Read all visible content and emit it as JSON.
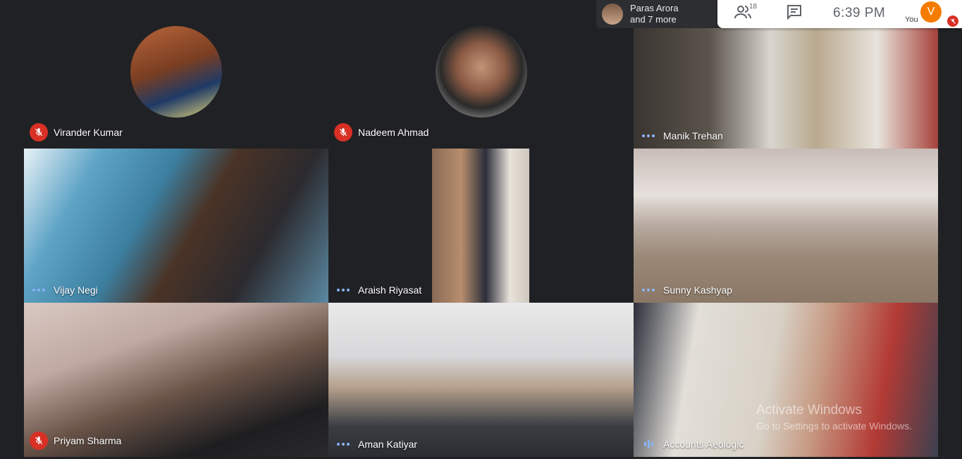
{
  "presenter": {
    "name": "Paras Arora",
    "more": "and 7 more"
  },
  "toolbar": {
    "participant_count": "18",
    "time": "6:39  PM",
    "self_initial": "V",
    "self_label": "You"
  },
  "participants": [
    {
      "name": "Virander Kumar",
      "mic": "muted",
      "video": "avatar"
    },
    {
      "name": "Nadeem Ahmad",
      "mic": "muted",
      "video": "avatar"
    },
    {
      "name": "Manik Trehan",
      "mic": "idle",
      "video": "camera"
    },
    {
      "name": "Vijay Negi",
      "mic": "idle",
      "video": "camera"
    },
    {
      "name": "Araish Riyasat",
      "mic": "idle",
      "video": "camera"
    },
    {
      "name": "Sunny Kashyap",
      "mic": "idle",
      "video": "camera"
    },
    {
      "name": "Priyam Sharma",
      "mic": "muted",
      "video": "camera"
    },
    {
      "name": "Aman Katiyar",
      "mic": "idle",
      "video": "camera"
    },
    {
      "name": "Accounts Aeologic",
      "mic": "speaking",
      "video": "camera"
    }
  ],
  "watermark": {
    "title": "Activate Windows",
    "subtitle": "Go to Settings to activate Windows."
  },
  "colors": {
    "background": "#202124",
    "muted": "#d93025",
    "accent": "#8ab4f8",
    "self_avatar": "#f57c00"
  }
}
